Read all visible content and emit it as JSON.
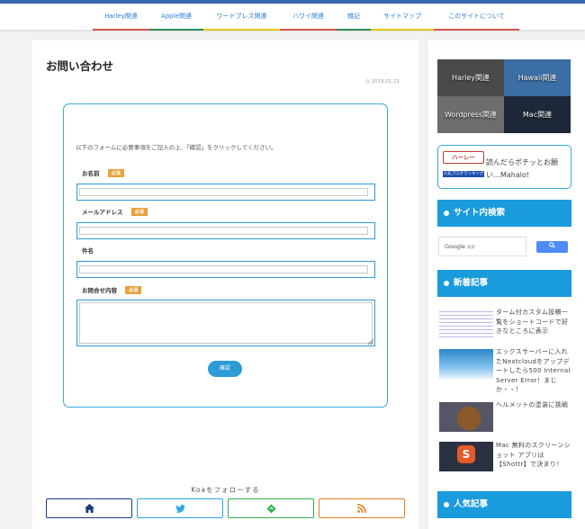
{
  "nav": {
    "items": [
      {
        "label": "Harley関連",
        "color": "#d9534f"
      },
      {
        "label": "Apple関連",
        "color": "#2e8b57"
      },
      {
        "label": "ワードプレス関連",
        "color": "#e6c700"
      },
      {
        "label": "ハワイ関連",
        "color": "#d9534f"
      },
      {
        "label": "雑記",
        "color": "#2e8b57"
      },
      {
        "label": "サイトマップ",
        "color": "#e6c700"
      },
      {
        "label": "このサイトについて",
        "color": "#d9534f"
      }
    ]
  },
  "main": {
    "title": "お問い合わせ",
    "date": "2019.01.22",
    "form": {
      "instruction": "以下のフォームに必要事項をご記入の上、「確認」をクリックしてください。",
      "required_badge": "必須",
      "fields": [
        {
          "label": "お名前",
          "required": true
        },
        {
          "label": "メールアドレス",
          "required": true
        },
        {
          "label": "件名",
          "required": false
        },
        {
          "label": "お問合せ内容",
          "required": true
        }
      ],
      "submit_label": "確認"
    },
    "follow": {
      "label": "Koaをフォローする",
      "buttons": [
        {
          "icon": "home-icon",
          "color": "#1c3f7a"
        },
        {
          "icon": "twitter-icon",
          "color": "#2ca7e0"
        },
        {
          "icon": "feedly-icon",
          "color": "#2bb24c"
        },
        {
          "icon": "rss-icon",
          "color": "#e67e22"
        }
      ]
    }
  },
  "sidebar": {
    "categories": [
      {
        "label": "Harley関連",
        "color": "#4a4a4a"
      },
      {
        "label": "Hawaii関連",
        "color": "#3a6ea5"
      },
      {
        "label": "Wordpress関連",
        "color": "#6d6d6d"
      },
      {
        "label": "Mac関連",
        "color": "#1e2838"
      }
    ],
    "harley_banner": {
      "logo": "ハーレー",
      "badge": "人気ブログランキング",
      "text": "読んだらポチッとお願い…Mahalo!"
    },
    "search": {
      "title": "サイト内検索",
      "google": "Google",
      "google_small": "検索",
      "button_icon": "search-icon"
    },
    "recent": {
      "title": "新着記事",
      "posts": [
        {
          "title": "ターム付カスタム投稿一覧をショートコードで好きなところに表示"
        },
        {
          "title": "エックスサーバーに入れたNextcloudをアップデートしたら500 Internal Server Error！まじか・・！"
        },
        {
          "title": "ヘルメットの塗装に挑戦"
        },
        {
          "title": "Mac 無料のスクリーンショット アプリは【Shottr】で決まり！"
        }
      ]
    },
    "popular": {
      "title": "人気記事"
    }
  }
}
